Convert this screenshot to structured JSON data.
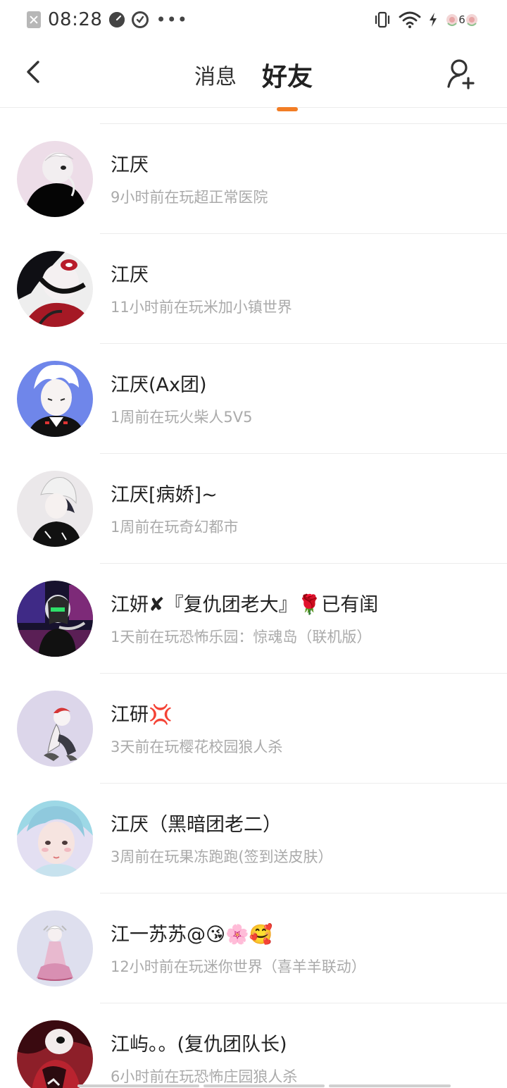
{
  "status_bar": {
    "time": "08:28",
    "dots": "•••",
    "battery_level": "6"
  },
  "nav": {
    "tabs": [
      {
        "label": "消息",
        "active": false
      },
      {
        "label": "好友",
        "active": true
      }
    ]
  },
  "friends": [
    {
      "name": "江厌",
      "status": "9小时前在玩超正常医院",
      "avatar": "avatar-1"
    },
    {
      "name": "江厌",
      "status": "11小时前在玩米加小镇世界",
      "avatar": "avatar-2"
    },
    {
      "name": "江厌(Ax团)",
      "status": "1周前在玩火柴人5V5",
      "avatar": "avatar-3"
    },
    {
      "name": "江厌[病娇]~",
      "status": "1周前在玩奇幻都市",
      "avatar": "avatar-4"
    },
    {
      "name": "江妍✘『复仇团老大』🌹已有闺",
      "status": "1天前在玩恐怖乐园：惊魂岛（联机版）",
      "avatar": "avatar-5"
    },
    {
      "name": "江研💢",
      "status": "3天前在玩樱花校园狼人杀",
      "avatar": "avatar-6"
    },
    {
      "name": "江厌（黑暗团老二）",
      "status": "3周前在玩果冻跑跑(签到送皮肤）",
      "avatar": "avatar-7"
    },
    {
      "name": "江一苏苏@😘🌸🥰",
      "status": "12小时前在玩迷你世界（喜羊羊联动）",
      "avatar": "avatar-8"
    },
    {
      "name": "江屿。。(复仇团队长)",
      "status": "6小时前在玩恐怖庄园狼人杀",
      "avatar": "avatar-9"
    }
  ],
  "colors": {
    "accent": "#f27d25",
    "text_primary": "#222222",
    "text_secondary": "#aaaaaa",
    "divider": "#ececec"
  }
}
